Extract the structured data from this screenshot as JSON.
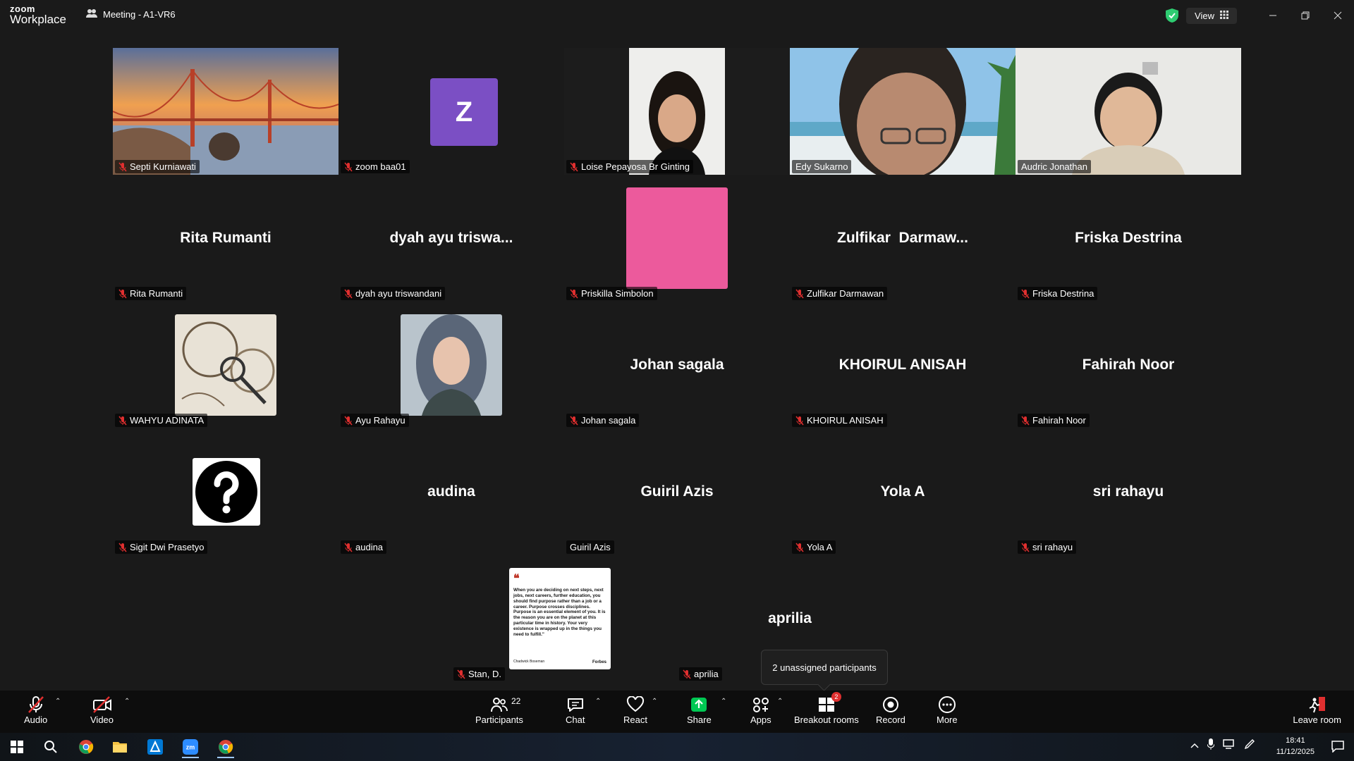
{
  "app": {
    "logo_top": "zoom",
    "logo_bottom": "Workplace",
    "meeting_title": "Meeting - A1-VR6",
    "view_label": "View"
  },
  "tiles": [
    {
      "name": "Septi Kurniawati"
    },
    {
      "name": "zoom baa01",
      "initial": "Z"
    },
    {
      "name": "Loise Pepayosa Br Ginting"
    },
    {
      "name": "Edy Sukarno"
    },
    {
      "name": "Audric Jonathan"
    },
    {
      "name": "Rita Rumanti",
      "big": "Rita Rumanti"
    },
    {
      "name": "dyah ayu triswandani",
      "big": "dyah ayu triswa..."
    },
    {
      "name": "Priskilla Simbolon"
    },
    {
      "name": "Zulfikar Darmawan",
      "big": "Zulfikar  Darmaw..."
    },
    {
      "name": "Friska Destrina",
      "big": "Friska Destrina"
    },
    {
      "name": "WAHYU ADINATA"
    },
    {
      "name": "Ayu Rahayu"
    },
    {
      "name": "Johan sagala",
      "big": "Johan sagala"
    },
    {
      "name": "KHOIRUL ANISAH",
      "big": "KHOIRUL ANISAH"
    },
    {
      "name": "Fahirah Noor",
      "big": "Fahirah Noor"
    },
    {
      "name": "Sigit Dwi Prasetyo"
    },
    {
      "name": "audina",
      "big": "audina"
    },
    {
      "name": "Guiril Azis",
      "big": "Guiril Azis"
    },
    {
      "name": "Yola A",
      "big": "Yola A"
    },
    {
      "name": "sri rahayu",
      "big": "sri rahayu"
    },
    {
      "name": "Stan, D."
    },
    {
      "name": "aprilia",
      "big": "aprilia"
    }
  ],
  "quote_card": {
    "text": "When you are deciding on next steps, next jobs, next careers, further education, you should find purpose rather than a job or a career. Purpose crosses disciplines. Purpose is an essential element of you. It is the reason you are on the planet at this particular time in history. Your very existence is wrapped up in the things you need to fulfill.\"",
    "author": "Chadwick Boseman",
    "brand": "Forbes"
  },
  "tooltip": "2 unassigned participants",
  "toolbar": {
    "audio": "Audio",
    "video": "Video",
    "participants": "Participants",
    "participants_count": "22",
    "chat": "Chat",
    "react": "React",
    "share": "Share",
    "apps": "Apps",
    "breakout": "Breakout rooms",
    "breakout_badge": "2",
    "record": "Record",
    "more": "More",
    "leave": "Leave room"
  },
  "taskbar": {
    "time": "18:41",
    "date": "11/12/2025"
  },
  "colors": {
    "speaking_border": "#2ecc71",
    "share_green": "#00c853",
    "mute_red": "#e02f2f",
    "avatar_purple": "#7b4fc4",
    "avatar_pink": "#ec5a9c"
  }
}
